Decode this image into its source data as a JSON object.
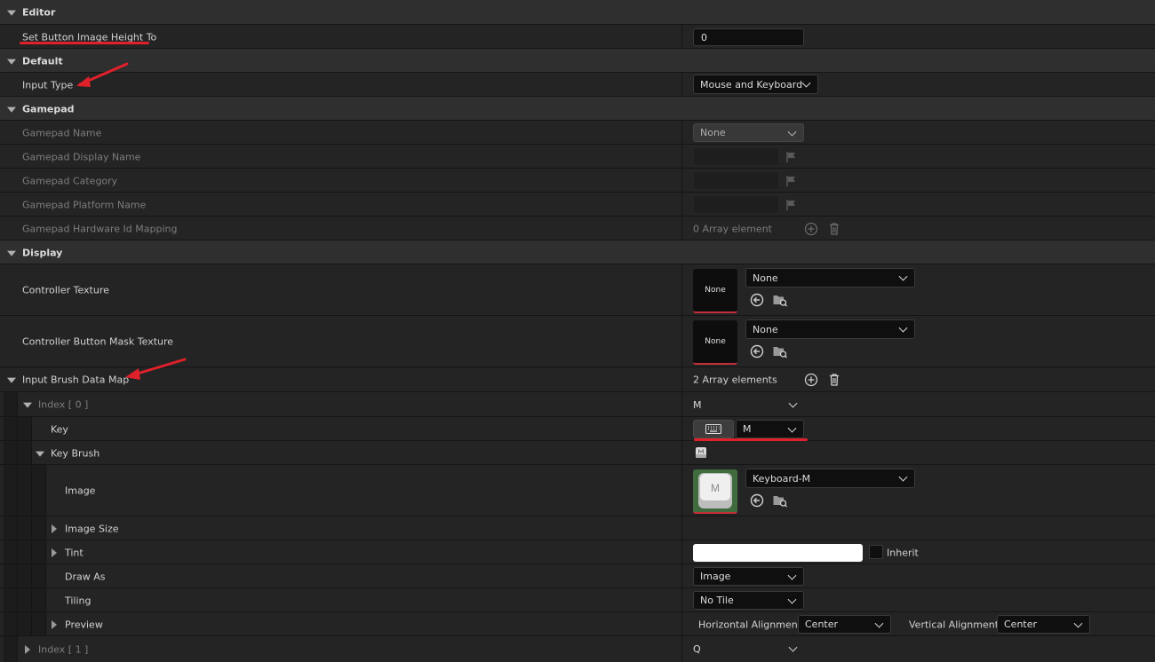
{
  "sections": {
    "editor": "Editor",
    "default": "Default",
    "gamepad": "Gamepad",
    "display": "Display"
  },
  "editor": {
    "set_button_height_label": "Set Button Image Height To",
    "set_button_height_value": "0"
  },
  "default": {
    "input_type_label": "Input Type",
    "input_type_value": "Mouse and Keyboard"
  },
  "gamepad": {
    "name_label": "Gamepad Name",
    "name_value": "None",
    "display_name_label": "Gamepad Display Name",
    "category_label": "Gamepad Category",
    "platform_name_label": "Gamepad Platform Name",
    "hw_mapping_label": "Gamepad Hardware Id Mapping",
    "hw_mapping_value": "0 Array element"
  },
  "display": {
    "controller_texture_label": "Controller Texture",
    "controller_texture_thumb": "None",
    "controller_texture_value": "None",
    "mask_texture_label": "Controller Button Mask Texture",
    "mask_texture_thumb": "None",
    "mask_texture_value": "None",
    "brush_map_label": "Input Brush Data Map",
    "brush_map_value": "2 Array elements"
  },
  "index0": {
    "label": "Index [ 0 ]",
    "value": "M",
    "key_label": "Key",
    "key_value": "M",
    "key_brush_label": "Key Brush",
    "image_label": "Image",
    "image_value": "Keyboard-M",
    "image_glyph": "M",
    "image_size_label": "Image Size",
    "tint_label": "Tint",
    "tint_inherit": "Inherit",
    "draw_as_label": "Draw As",
    "draw_as_value": "Image",
    "tiling_label": "Tiling",
    "tiling_value": "No Tile",
    "preview_label": "Preview",
    "h_align_label": "Horizontal Alignment",
    "h_align_value": "Center",
    "v_align_label": "Vertical Alignment",
    "v_align_value": "Center"
  },
  "index1": {
    "label": "Index [ 1 ]",
    "value": "Q"
  },
  "colors": {
    "accent_red": "#e0212b",
    "thumb_underline": "#c4303a"
  }
}
